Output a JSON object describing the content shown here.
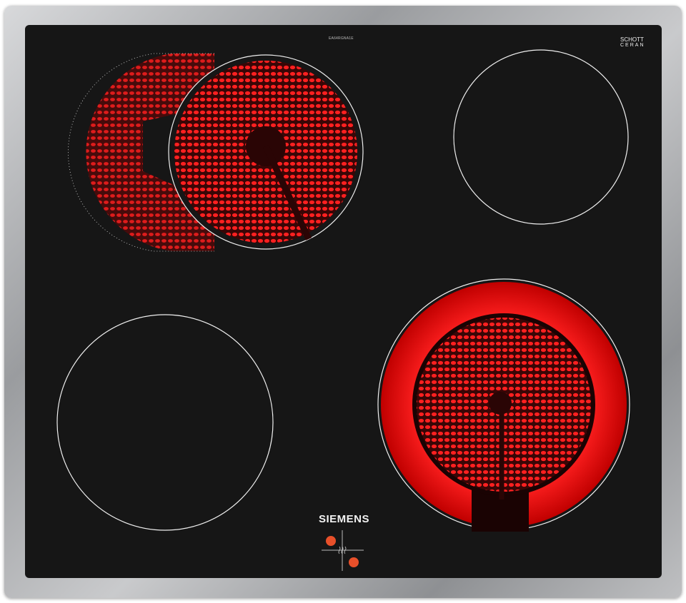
{
  "product": {
    "model_label": "EA64RGNA1E",
    "glass_brand_line1": "SCHOTT",
    "glass_brand_line2": "CERAN",
    "serial_label": "",
    "brand": "SIEMENS"
  },
  "zones": [
    {
      "id": "front-left-dual-oval",
      "state": "on"
    },
    {
      "id": "back-right",
      "state": "off"
    },
    {
      "id": "back-left",
      "state": "off"
    },
    {
      "id": "front-right-dual-circle",
      "state": "on"
    }
  ],
  "controls": {
    "icon": "heat-waves-icon",
    "indicator_color": "#e8502a"
  },
  "colors": {
    "glass": "#161616",
    "heating": "#ff1a1a",
    "frame": "#b0b2b4"
  }
}
